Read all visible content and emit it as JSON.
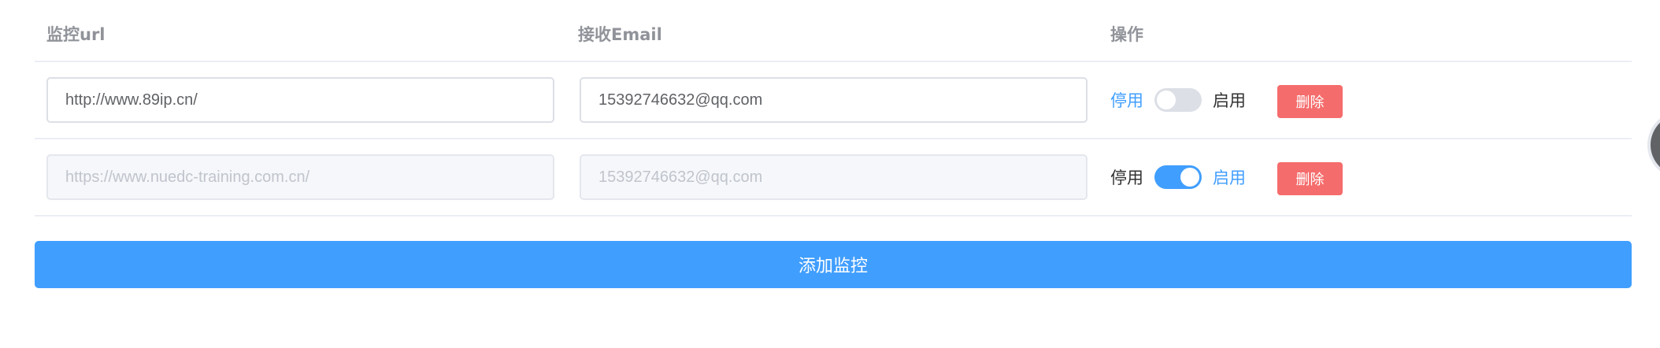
{
  "table": {
    "headers": [
      "监控url",
      "接收Email",
      "操作"
    ],
    "rows": [
      {
        "url": "http://www.89ip.cn/",
        "email": "15392746632@qq.com",
        "enabled": false,
        "disabled_label": "停用",
        "enabled_label": "启用",
        "delete_label": "删除"
      },
      {
        "url": "https://www.nuedc-training.com.cn/",
        "email": "15392746632@qq.com",
        "enabled": true,
        "disabled_label": "停用",
        "enabled_label": "启用",
        "delete_label": "删除"
      }
    ]
  },
  "add_button_label": "添加监控",
  "colors": {
    "primary": "#409eff",
    "danger": "#f56c6c",
    "header_text": "#909399",
    "border": "#ebeef5"
  }
}
